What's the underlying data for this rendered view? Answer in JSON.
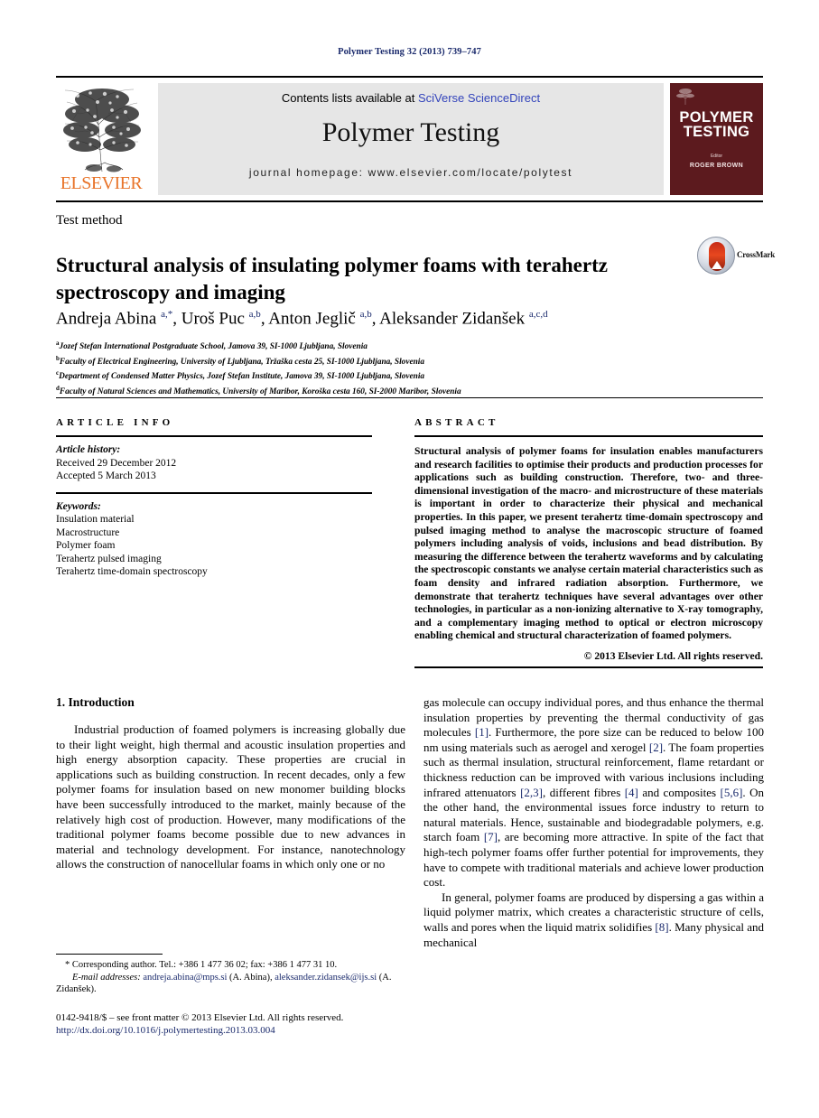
{
  "running_head": "Polymer Testing 32 (2013) 739–747",
  "masthead": {
    "contents_prefix": "Contents lists available at ",
    "contents_link": "SciVerse ScienceDirect",
    "journal_title": "Polymer Testing",
    "homepage": "journal  homepage:  www.elsevier.com/locate/polytest",
    "publisher_wordmark": "ELSEVIER",
    "cover": {
      "title_line1": "POLYMER",
      "title_line2": "TESTING",
      "editor_label": "Editor",
      "editor_name": "ROGER BROWN"
    }
  },
  "article": {
    "section_label": "Test method",
    "title": "Structural analysis of insulating polymer foams with terahertz spectroscopy and imaging",
    "crossmark_label": "CrossMark",
    "authors_html": "Andreja Abina <sup>a,*</sup>, Uroš Puc <sup>a,b</sup>, Anton Jeglič <sup>a,b</sup>, Aleksander Zidanšek <sup>a,c,d</sup>",
    "affiliations": [
      {
        "marker": "a",
        "text": "Jozef Stefan International Postgraduate School, Jamova 39, SI-1000 Ljubljana, Slovenia"
      },
      {
        "marker": "b",
        "text": "Faculty of Electrical Engineering, University of Ljubljana, Tržaška cesta 25, SI-1000 Ljubljana, Slovenia"
      },
      {
        "marker": "c",
        "text": "Department of Condensed Matter Physics, Jozef Stefan Institute, Jamova 39, SI-1000 Ljubljana, Slovenia"
      },
      {
        "marker": "d",
        "text": "Faculty of Natural Sciences and Mathematics, University of Maribor, Koroška cesta 160, SI-2000 Maribor, Slovenia"
      }
    ]
  },
  "article_info": {
    "heading": "ARTICLE INFO",
    "history_label": "Article history:",
    "received": "Received 29 December 2012",
    "accepted": "Accepted 5 March 2013",
    "keywords_label": "Keywords:",
    "keywords": [
      "Insulation material",
      "Macrostructure",
      "Polymer foam",
      "Terahertz pulsed imaging",
      "Terahertz time-domain spectroscopy"
    ]
  },
  "abstract": {
    "heading": "ABSTRACT",
    "text": "Structural analysis of polymer foams for insulation enables manufacturers and research facilities to optimise their products and production processes for applications such as building construction. Therefore, two- and three-dimensional investigation of the macro- and microstructure of these materials is important in order to characterize their physical and mechanical properties. In this paper, we present terahertz time-domain spectroscopy and pulsed imaging method to analyse the macroscopic structure of foamed polymers including analysis of voids, inclusions and bead distribution. By measuring the difference between the terahertz waveforms and by calculating the spectroscopic constants we analyse certain material characteristics such as foam density and infrared radiation absorption. Furthermore, we demonstrate that terahertz techniques have several advantages over other technologies, in particular as a non-ionizing alternative to X-ray tomography, and a complementary imaging method to optical or electron microscopy enabling chemical and structural characterization of foamed polymers.",
    "copyright": "© 2013 Elsevier Ltd. All rights reserved."
  },
  "body": {
    "section_heading": "1. Introduction",
    "left_paragraphs": [
      "Industrial production of foamed polymers is increasing globally due to their light weight, high thermal and acoustic insulation properties and high energy absorption capacity. These properties are crucial in applications such as building construction. In recent decades, only a few polymer foams for insulation based on new monomer building blocks have been successfully introduced to the market, mainly because of the relatively high cost of production. However, many modifications of the traditional polymer foams become possible due to new advances in material and technology development. For instance, nanotechnology allows the construction of nanocellular foams in which only one or no"
    ],
    "right_paragraph_1_segments": [
      {
        "t": "gas molecule can occupy individual pores, and thus enhance the thermal insulation properties by preventing the thermal conductivity of gas molecules "
      },
      {
        "t": "[1]",
        "ref": true
      },
      {
        "t": ". Furthermore, the pore size can be reduced to below 100 nm using materials such as aerogel and xerogel "
      },
      {
        "t": "[2]",
        "ref": true
      },
      {
        "t": ". The foam properties such as thermal insulation, structural reinforcement, flame retardant or thickness reduction can be improved with various inclusions including infrared attenuators "
      },
      {
        "t": "[2,3]",
        "ref": true
      },
      {
        "t": ", different fibres "
      },
      {
        "t": "[4]",
        "ref": true
      },
      {
        "t": " and composites "
      },
      {
        "t": "[5,6]",
        "ref": true
      },
      {
        "t": ". On the other hand, the environmental issues force industry to return to natural materials. Hence, sustainable and biodegradable polymers, e.g. starch foam "
      },
      {
        "t": "[7]",
        "ref": true
      },
      {
        "t": ", are becoming more attractive. In spite of the fact that high-tech polymer foams offer further potential for improvements, they have to compete with traditional materials and achieve lower production cost."
      }
    ],
    "right_paragraph_2_segments": [
      {
        "t": "In general, polymer foams are produced by dispersing a gas within a liquid polymer matrix, which creates a characteristic structure of cells, walls and pores when the liquid matrix solidifies "
      },
      {
        "t": "[8]",
        "ref": true
      },
      {
        "t": ". Many physical and mechanical"
      }
    ]
  },
  "footnote": {
    "corresponding": "* Corresponding author. Tel.: +386 1 477 36 02; fax: +386 1 477 31 10.",
    "email_label": "E-mail addresses:",
    "email_1": "andreja.abina@mps.si",
    "email_1_name": "(A. Abina),",
    "email_2": "aleksander.zidansek@ijs.si",
    "email_2_name": "(A. Zidanšek)."
  },
  "imprint": {
    "line1": "0142-9418/$ – see front matter © 2013 Elsevier Ltd. All rights reserved.",
    "doi": "http://dx.doi.org/10.1016/j.polymertesting.2013.03.004"
  },
  "colors": {
    "link_blue": "#3344bb",
    "ref_navy": "#1a2a6c",
    "elsevier_orange": "#E8742A",
    "cover_maroon": "#5c1a1e",
    "banner_grey": "#e6e6e6"
  }
}
